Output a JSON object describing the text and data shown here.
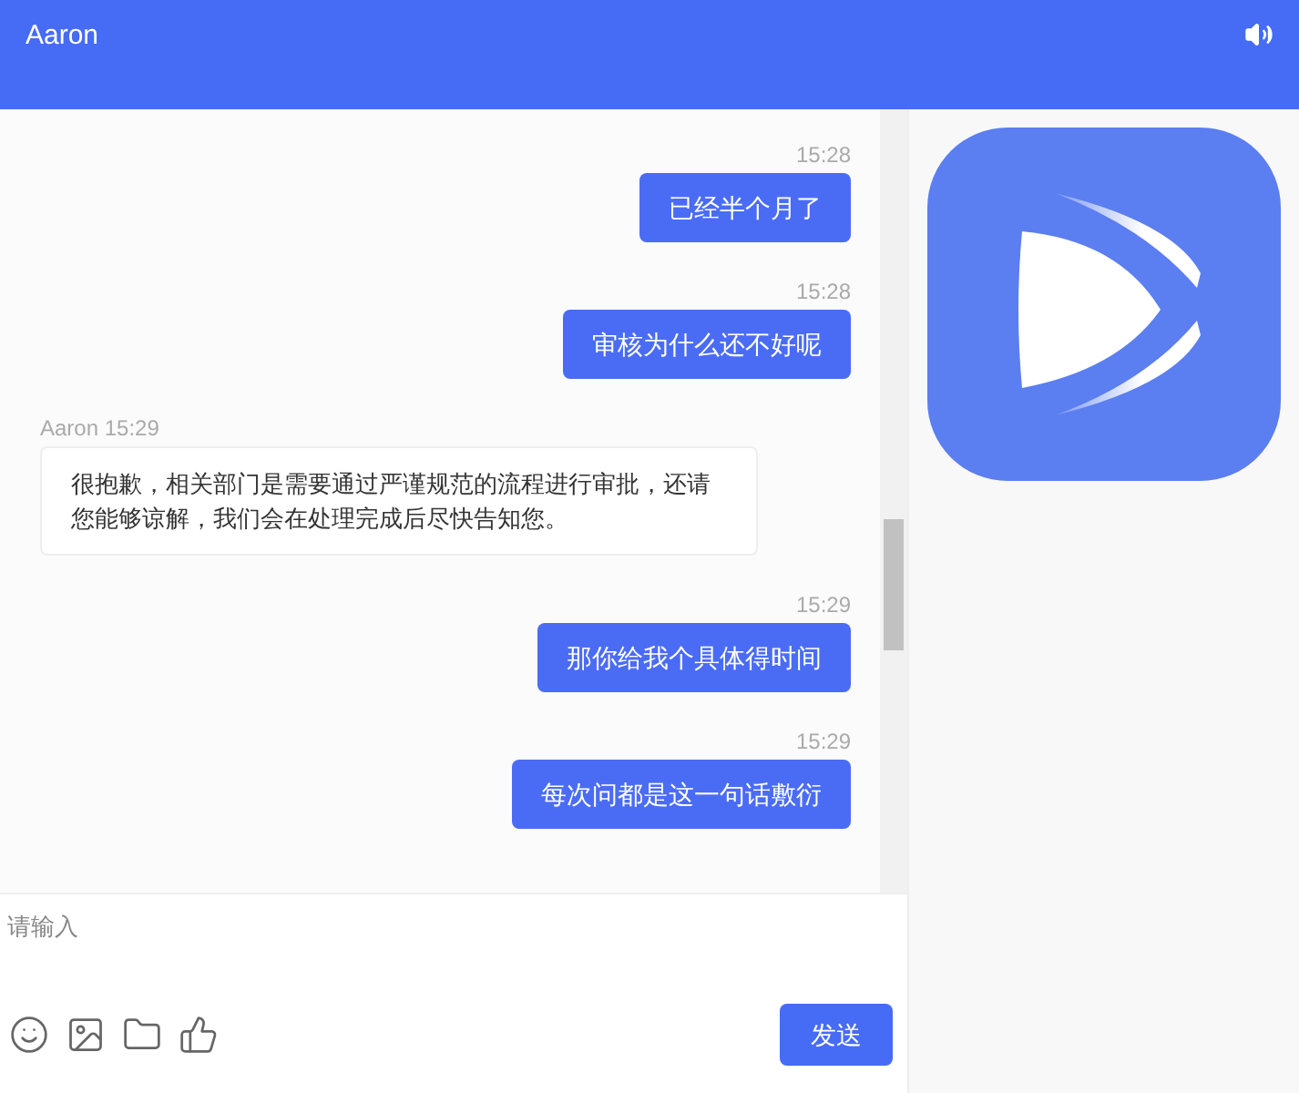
{
  "header": {
    "title": "Aaron"
  },
  "messages": [
    {
      "kind": "sent",
      "meta": "15:28",
      "text": "已经半个月了"
    },
    {
      "kind": "sent",
      "meta": "15:28",
      "text": "审核为什么还不好呢"
    },
    {
      "kind": "received",
      "meta": "Aaron 15:29",
      "text": "很抱歉，相关部门是需要通过严谨规范的流程进行审批，还请您能够谅解，我们会在处理完成后尽快告知您。"
    },
    {
      "kind": "sent",
      "meta": "15:29",
      "text": "那你给我个具体得时间"
    },
    {
      "kind": "sent",
      "meta": "15:29",
      "text": "每次问都是这一句话敷衍"
    }
  ],
  "composer": {
    "placeholder": "请输入",
    "send_button": "发送"
  }
}
